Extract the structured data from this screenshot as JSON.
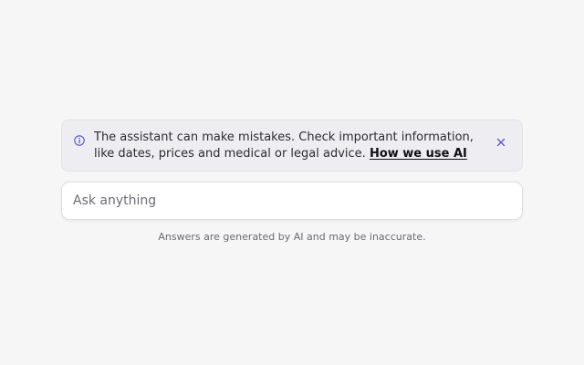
{
  "notice": {
    "icon": "info-icon",
    "text": "The assistant can make mistakes. Check important information, like dates, prices and medical or legal advice.",
    "link_label": "How we use AI",
    "close_icon": "close-icon",
    "accent_color": "#5b52c8"
  },
  "ask": {
    "placeholder": "Ask anything",
    "value": ""
  },
  "disclaimer": {
    "text": "Answers are generated by AI and may be inaccurate."
  }
}
